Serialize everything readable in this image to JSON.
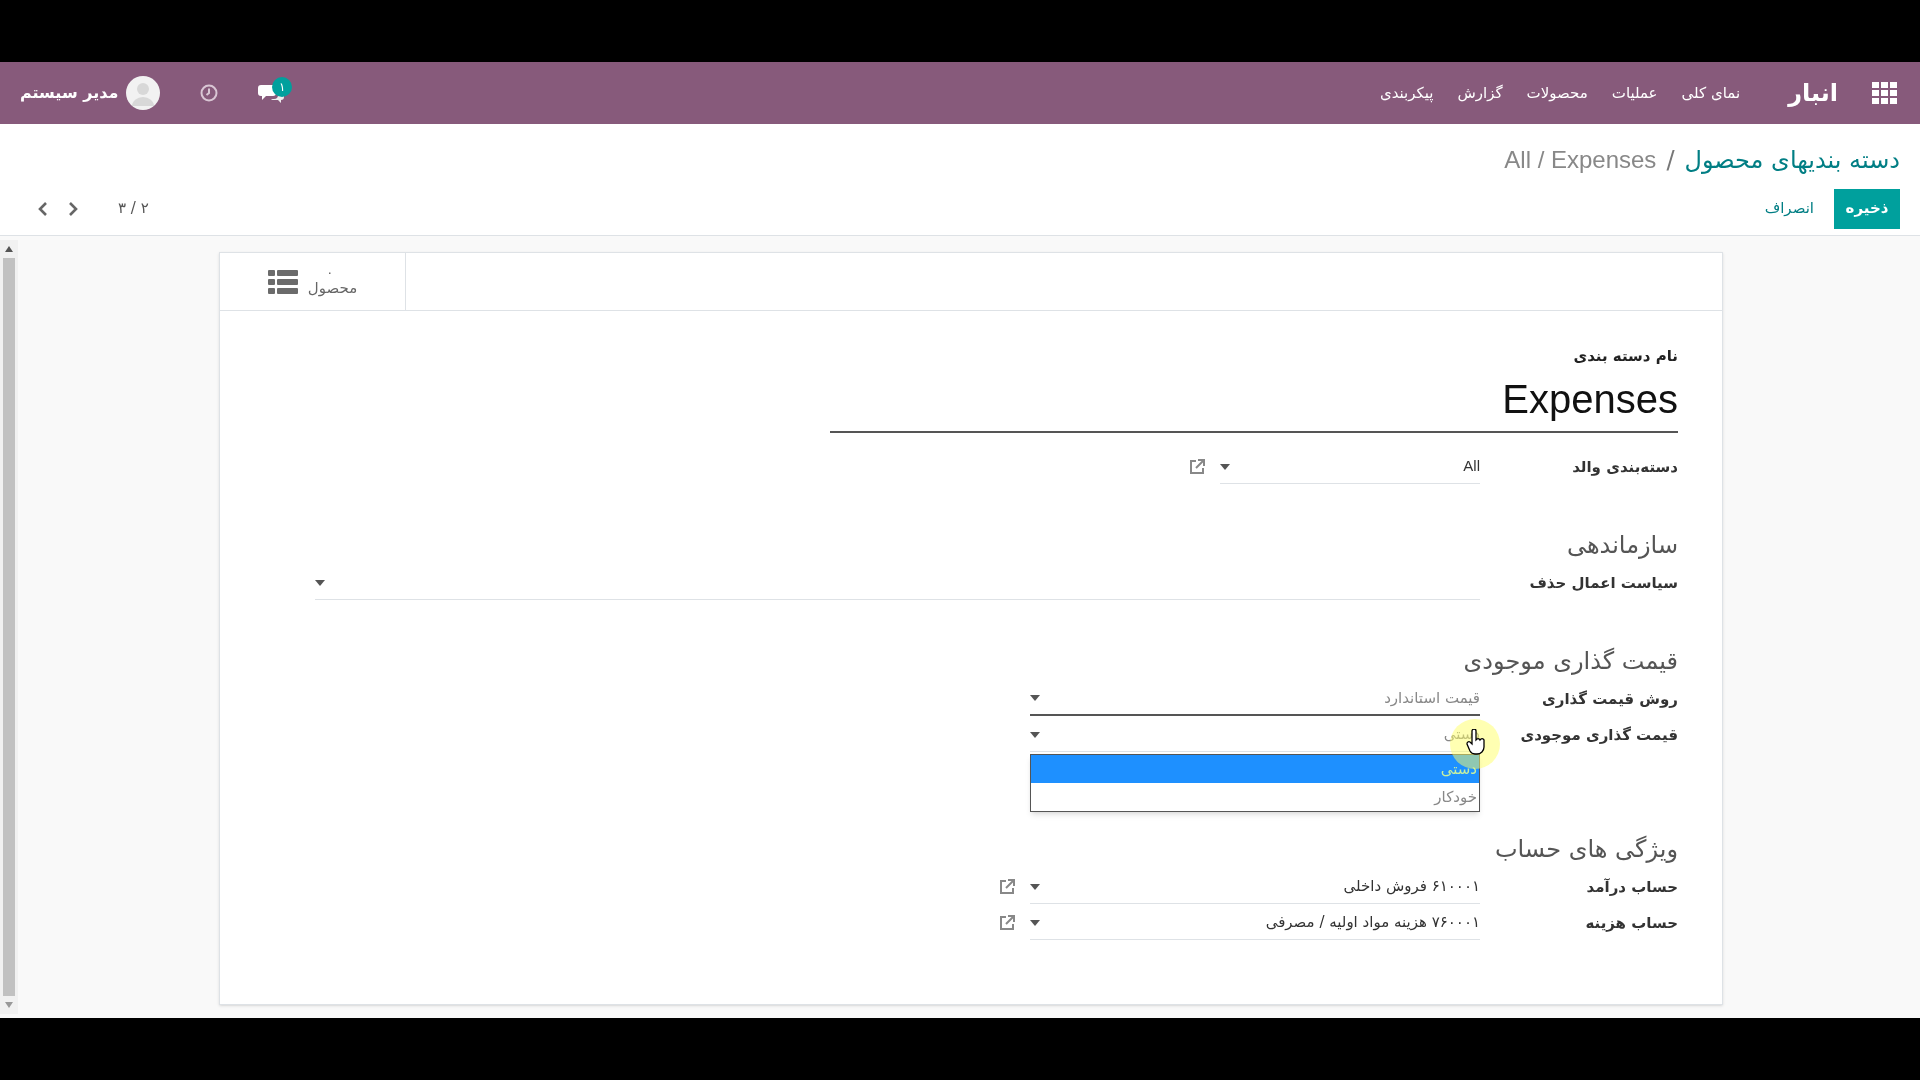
{
  "navbar": {
    "brand": "انبار",
    "menu": [
      {
        "label": "نمای کلی"
      },
      {
        "label": "عملیات"
      },
      {
        "label": "محصولات"
      },
      {
        "label": "گزارش"
      },
      {
        "label": "پیکربندی"
      }
    ],
    "messages_badge": "۱",
    "user": "مدیر سیستم"
  },
  "breadcrumbs": {
    "separator": "/",
    "items": [
      {
        "label": "دسته بندیهای محصول",
        "kind": "link"
      },
      {
        "label": "All / Expenses",
        "kind": "current"
      }
    ]
  },
  "actions": {
    "save": "ذخیره",
    "discard": "انصراف"
  },
  "pager": "۲ / ۳",
  "smart_button": {
    "value": "۰",
    "label": "محصول"
  },
  "form": {
    "name_label": "نام دسته بندی",
    "name": "Expenses",
    "rows": [
      {
        "kind": "relation",
        "label": "دسته‌بندی والد",
        "value": "All",
        "compact": true,
        "focused": false
      },
      {
        "kind": "heading",
        "label": "سازماندهی"
      },
      {
        "kind": "select",
        "label": "سیاست اعمال حذف",
        "wide": true,
        "focused": false
      },
      {
        "kind": "heading",
        "label": "قیمت گذاری موجودی"
      },
      {
        "kind": "select",
        "label": "روش قیمت گذاری",
        "value": "قیمت استاندارد",
        "focused": true
      },
      {
        "kind": "select",
        "label": "قیمت گذاری موجودی",
        "value": "دستی",
        "focused": false,
        "open": true,
        "options": [
          {
            "label": "دستی",
            "selected": true
          },
          {
            "label": "خودکار",
            "selected": false
          }
        ]
      },
      {
        "kind": "heading",
        "label": "ویژگی های حساب"
      },
      {
        "kind": "relation",
        "label": "حساب درآمد",
        "value": "۶۱۰۰۰۱ فروش داخلی",
        "focused": false
      },
      {
        "kind": "relation",
        "label": "حساب هزینه",
        "value": "۷۶۰۰۰۱ هزینه مواد اولیه / مصرفی",
        "focused": false
      }
    ]
  }
}
